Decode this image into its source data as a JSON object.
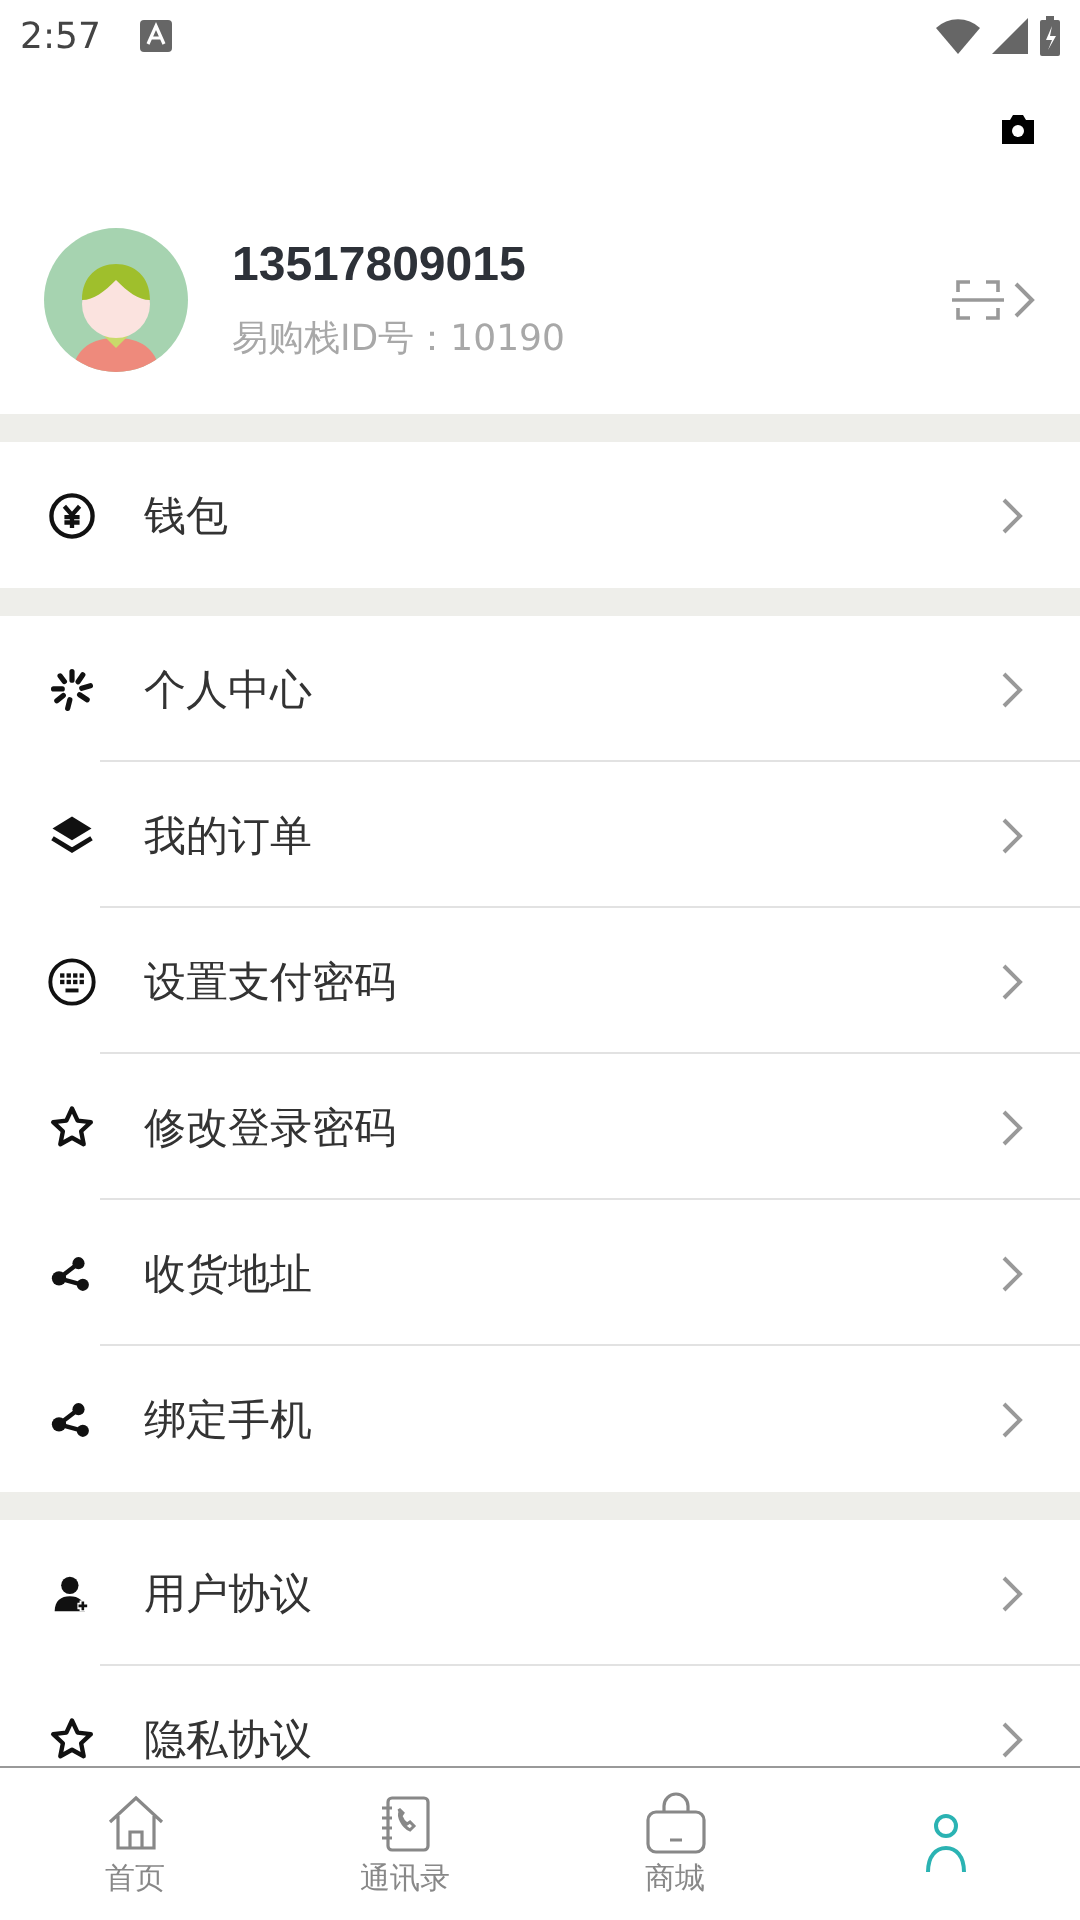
{
  "status_bar": {
    "time": "2:57"
  },
  "profile": {
    "phone": "13517809015",
    "id_label": "易购栈ID号：10190"
  },
  "sections": [
    {
      "items": [
        {
          "label": "钱包"
        }
      ]
    },
    {
      "items": [
        {
          "label": "个人中心"
        },
        {
          "label": "我的订单"
        },
        {
          "label": "设置支付密码"
        },
        {
          "label": "修改登录密码"
        },
        {
          "label": "收货地址"
        },
        {
          "label": "绑定手机"
        }
      ]
    },
    {
      "items": [
        {
          "label": "用户协议"
        },
        {
          "label": "隐私协议"
        }
      ]
    }
  ],
  "tab_bar": [
    {
      "label": "首页",
      "selected": false
    },
    {
      "label": "通讯录",
      "selected": false
    },
    {
      "label": "商城",
      "selected": false
    },
    {
      "selected": true
    }
  ]
}
